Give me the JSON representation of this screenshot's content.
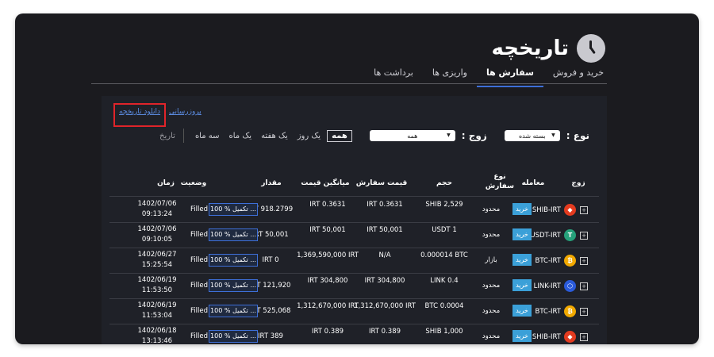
{
  "page": {
    "title": "تاریخچه"
  },
  "tabs": [
    {
      "label": "خرید و فروش",
      "active": false
    },
    {
      "label": "سفارش ها",
      "active": true
    },
    {
      "label": "واریزی ها",
      "active": false
    },
    {
      "label": "برداشت ها",
      "active": false
    }
  ],
  "actions": {
    "download_label": "دانلود تاریخچه",
    "refresh_label": "بروزرسانی"
  },
  "filters": {
    "type_label": "نوع :",
    "type_value": "بسته شده",
    "pair_label": "زوج :",
    "pair_value": "همه",
    "ranges": [
      {
        "label": "همه",
        "active": true
      },
      {
        "label": "یک روز",
        "active": false
      },
      {
        "label": "یک هفته",
        "active": false
      },
      {
        "label": "یک ماه",
        "active": false
      },
      {
        "label": "سه ماه",
        "active": false
      }
    ],
    "date_label": "تاریخ"
  },
  "table": {
    "headers": {
      "pair": "زوج",
      "side": "معامله",
      "order_type": "نوع سفارش",
      "volume": "حجم",
      "order_price": "قیمت سفارش",
      "avg_price": "میانگین قیمت",
      "amount": "مقدار",
      "status": "وضعیت",
      "time": "زمان"
    },
    "rows": [
      {
        "pair": "SHIB-IRT",
        "coin": "shib",
        "side": "خرید",
        "order_type": "محدود",
        "volume": "SHIB 2,529",
        "order_price": "IRT 0.3631",
        "avg_price": "IRT 0.3631",
        "amount": "IRT 918.2799",
        "progress": "100 % تکمیل ...",
        "status": "Filled",
        "date": "1402/07/06",
        "time": "09:13:24"
      },
      {
        "pair": "USDT-IRT",
        "coin": "usdt",
        "side": "خرید",
        "order_type": "محدود",
        "volume": "USDT 1",
        "order_price": "IRT 50,001",
        "avg_price": "IRT 50,001",
        "amount": "IRT 50,001",
        "progress": "100 % تکمیل ...",
        "status": "Filled",
        "date": "1402/07/06",
        "time": "09:10:05"
      },
      {
        "pair": "BTC-IRT",
        "coin": "btc",
        "side": "خرید",
        "order_type": "بازار",
        "volume": "0.000014 BTC",
        "order_price": "N/A",
        "avg_price": "1,369,590,000 IRT",
        "amount": "IRT 0",
        "progress": "100 % تکمیل ...",
        "status": "Filled",
        "date": "1402/06/27",
        "time": "15:25:54"
      },
      {
        "pair": "LINK-IRT",
        "coin": "link",
        "side": "خرید",
        "order_type": "محدود",
        "volume": "LINK 0.4",
        "order_price": "IRT 304,800",
        "avg_price": "IRT 304,800",
        "amount": "IRT 121,920",
        "progress": "100 % تکمیل ...",
        "status": "Filled",
        "date": "1402/06/19",
        "time": "11:53:50"
      },
      {
        "pair": "BTC-IRT",
        "coin": "btc",
        "side": "خرید",
        "order_type": "محدود",
        "volume": "BTC 0.0004",
        "order_price": "1,312,670,000 IRT",
        "avg_price": "1,312,670,000 IRT",
        "amount": "IRT 525,068",
        "progress": "100 % تکمیل ...",
        "status": "Filled",
        "date": "1402/06/19",
        "time": "11:53:04"
      },
      {
        "pair": "SHIB-IRT",
        "coin": "shib",
        "side": "خرید",
        "order_type": "محدود",
        "volume": "SHIB 1,000",
        "order_price": "IRT 0.389",
        "avg_price": "IRT 0.389",
        "amount": "IRT 389",
        "progress": "100 % تکمیل ...",
        "status": "Filled",
        "date": "1402/06/18",
        "time": "13:13:46"
      }
    ]
  },
  "colors": {
    "accent": "#3d6fd8",
    "buy_badge": "#3ba0d8",
    "highlight": "#e0242a",
    "usdt": "#26a17b",
    "btc": "#f2a900",
    "link": "#2a5ada",
    "shib": "#e43b1f"
  }
}
